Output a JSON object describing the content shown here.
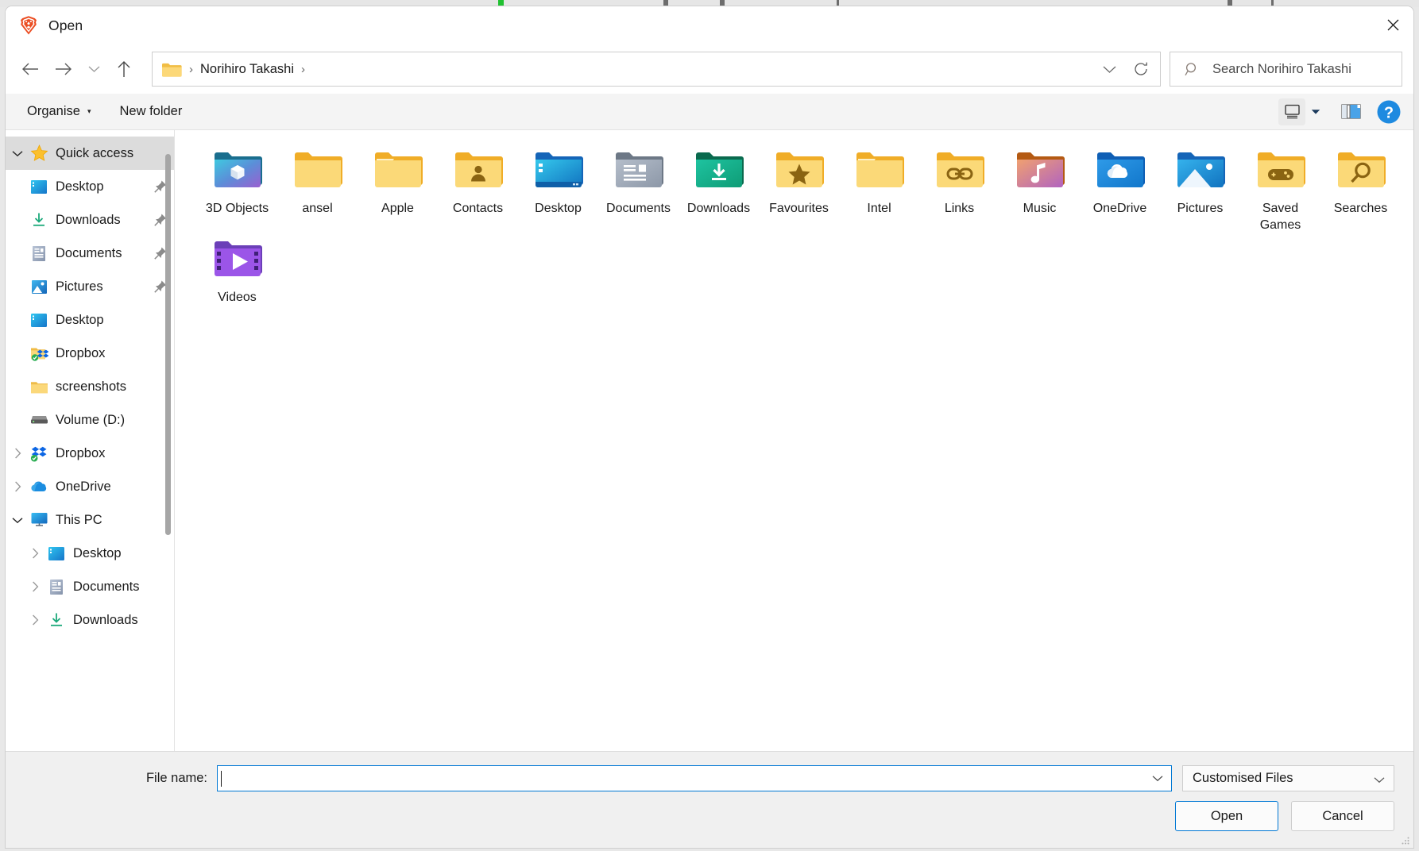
{
  "window": {
    "title": "Open",
    "app_icon": "brave-lion-icon",
    "close_label": "✕"
  },
  "nav": {
    "back_icon": "arrow-left-icon",
    "forward_icon": "arrow-right-icon",
    "recent_icon": "chevron-down-icon",
    "up_icon": "arrow-up-icon",
    "address": {
      "folder_icon": "folder-icon",
      "separator": "›",
      "path_label": "Norihiro Takashi",
      "dropdown_icon": "chevron-down-icon",
      "refresh_icon": "refresh-icon"
    },
    "search": {
      "icon": "search-icon",
      "placeholder": "Search Norihiro Takashi"
    }
  },
  "commandbar": {
    "organise_label": "Organise",
    "organise_caret": "▾",
    "new_folder_label": "New folder",
    "view_icon": "view-monitor-icon",
    "view_caret": "▾",
    "preview_pane_icon": "preview-pane-icon",
    "help_icon": "help-question-icon"
  },
  "sidebar": {
    "items": [
      {
        "label": "Quick access",
        "icon": "star-icon",
        "chevron": "down",
        "selected": true,
        "indent": 0,
        "pinned": false
      },
      {
        "label": "Desktop",
        "icon": "desktop-icon",
        "chevron": "none",
        "selected": false,
        "indent": 1,
        "pinned": true
      },
      {
        "label": "Downloads",
        "icon": "downloads-icon",
        "chevron": "none",
        "selected": false,
        "indent": 1,
        "pinned": true
      },
      {
        "label": "Documents",
        "icon": "documents-icon",
        "chevron": "none",
        "selected": false,
        "indent": 1,
        "pinned": true
      },
      {
        "label": "Pictures",
        "icon": "pictures-icon",
        "chevron": "none",
        "selected": false,
        "indent": 1,
        "pinned": true
      },
      {
        "label": "Desktop",
        "icon": "desktop-icon",
        "chevron": "none",
        "selected": false,
        "indent": 1,
        "pinned": false
      },
      {
        "label": "Dropbox",
        "icon": "dropbox-folder-icon",
        "chevron": "none",
        "selected": false,
        "indent": 1,
        "pinned": false
      },
      {
        "label": "screenshots",
        "icon": "folder-icon",
        "chevron": "none",
        "selected": false,
        "indent": 1,
        "pinned": false
      },
      {
        "label": "Volume (D:)",
        "icon": "drive-icon",
        "chevron": "none",
        "selected": false,
        "indent": 1,
        "pinned": false
      },
      {
        "label": "Dropbox",
        "icon": "dropbox-icon",
        "chevron": "right",
        "selected": false,
        "indent": 0,
        "pinned": false
      },
      {
        "label": "OneDrive",
        "icon": "onedrive-icon",
        "chevron": "right",
        "selected": false,
        "indent": 0,
        "pinned": false
      },
      {
        "label": "This PC",
        "icon": "thispc-icon",
        "chevron": "down",
        "selected": false,
        "indent": 0,
        "pinned": false
      },
      {
        "label": "Desktop",
        "icon": "desktop-icon",
        "chevron": "right",
        "selected": false,
        "indent": 2,
        "pinned": false
      },
      {
        "label": "Documents",
        "icon": "documents-icon",
        "chevron": "right",
        "selected": false,
        "indent": 2,
        "pinned": false
      },
      {
        "label": "Downloads",
        "icon": "downloads-icon",
        "chevron": "right",
        "selected": false,
        "indent": 2,
        "pinned": false
      }
    ]
  },
  "files": {
    "items": [
      {
        "name": "3D Objects",
        "icon": "folder-3dobjects-icon"
      },
      {
        "name": "ansel",
        "icon": "folder-icon"
      },
      {
        "name": "Apple",
        "icon": "folder-icon"
      },
      {
        "name": "Contacts",
        "icon": "folder-contacts-icon"
      },
      {
        "name": "Desktop",
        "icon": "folder-desktop-icon"
      },
      {
        "name": "Documents",
        "icon": "folder-documents-icon"
      },
      {
        "name": "Downloads",
        "icon": "folder-downloads-icon"
      },
      {
        "name": "Favourites",
        "icon": "folder-favourites-icon"
      },
      {
        "name": "Intel",
        "icon": "folder-icon"
      },
      {
        "name": "Links",
        "icon": "folder-links-icon"
      },
      {
        "name": "Music",
        "icon": "folder-music-icon"
      },
      {
        "name": "OneDrive",
        "icon": "folder-onedrive-icon"
      },
      {
        "name": "Pictures",
        "icon": "folder-pictures-icon"
      },
      {
        "name": "Saved Games",
        "icon": "folder-savedgames-icon"
      },
      {
        "name": "Searches",
        "icon": "folder-searches-icon"
      },
      {
        "name": "Videos",
        "icon": "folder-videos-icon"
      }
    ]
  },
  "footer": {
    "filename_label": "File name:",
    "filename_value": "",
    "filename_dropdown_icon": "chevron-down-icon",
    "filetype_value": "Customised Files",
    "filetype_dropdown_icon": "chevron-down-icon",
    "open_label": "Open",
    "cancel_label": "Cancel"
  },
  "colors": {
    "accent": "#0078d4",
    "folder_yellow": "#f7c559",
    "selection_gray": "#dcdcdc",
    "brave_orange": "#eb4d22"
  }
}
